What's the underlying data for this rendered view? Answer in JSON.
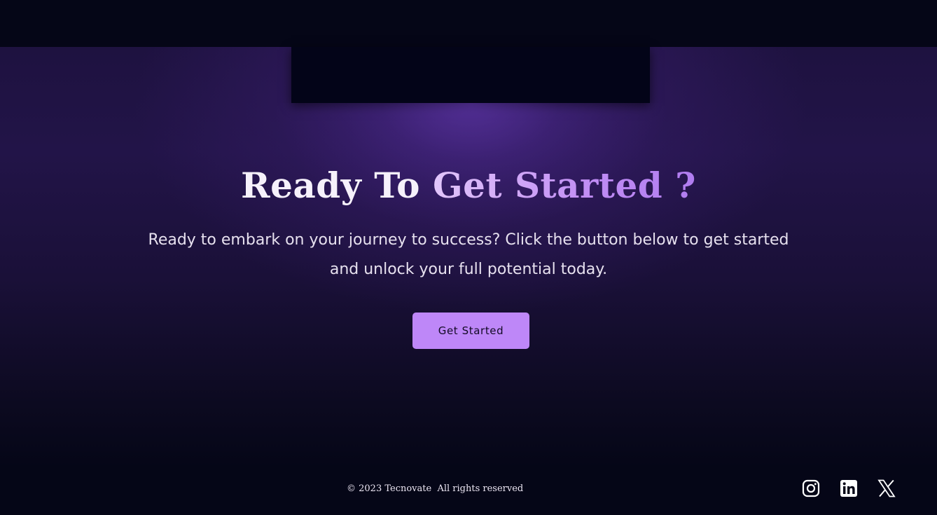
{
  "hero": {
    "headline_part1": "Ready To ",
    "headline_part2": "Get Started ?",
    "subtitle": "Ready to embark on your journey to success? Click the button below to get started and unlock your full potential today.",
    "cta_label": "Get Started"
  },
  "footer": {
    "copyright": "© 2023 Tecnovate  All rights reserved",
    "social_links": [
      {
        "name": "instagram",
        "icon": "instagram-icon"
      },
      {
        "name": "linkedin",
        "icon": "linkedin-icon"
      },
      {
        "name": "x",
        "icon": "x-icon"
      }
    ]
  },
  "colors": {
    "background": "#050617",
    "section_top": "#1e1240",
    "accent": "#be87f8",
    "headline_accent": "#c89cf6",
    "text_light": "#e7e1ef"
  }
}
